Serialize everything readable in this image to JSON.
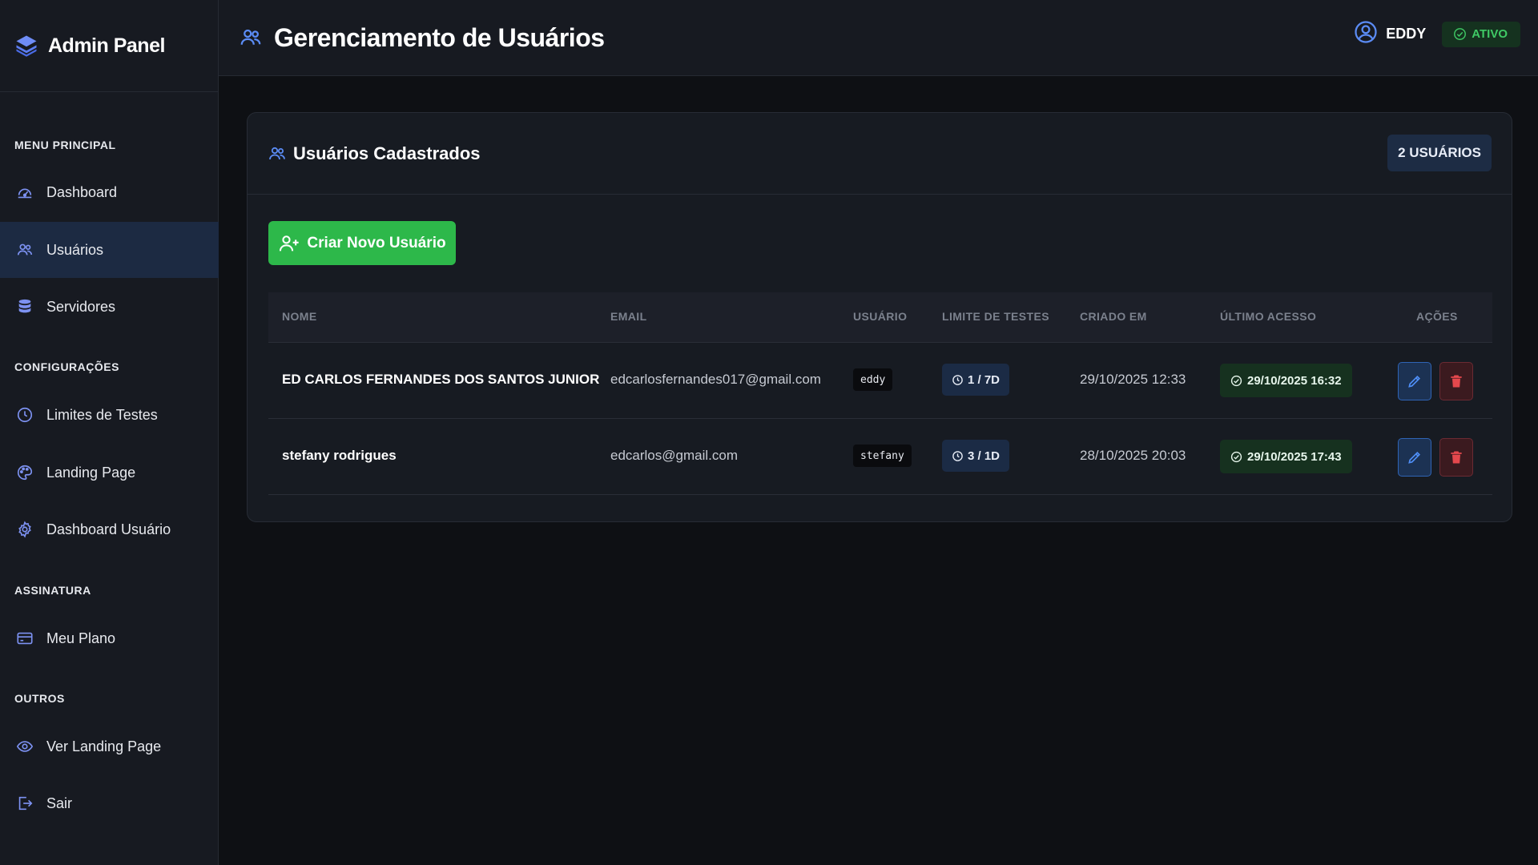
{
  "app": {
    "brand": "Admin Panel"
  },
  "header": {
    "title": "Gerenciamento de Usuários",
    "user_name": "EDDY",
    "status": "ATIVO"
  },
  "sidebar": {
    "sections": [
      {
        "title": "MENU PRINCIPAL",
        "items": [
          {
            "label": "Dashboard",
            "icon": "dashboard-icon"
          },
          {
            "label": "Usuários",
            "icon": "users-icon",
            "active": true
          },
          {
            "label": "Servidores",
            "icon": "database-icon"
          }
        ]
      },
      {
        "title": "CONFIGURAÇÕES",
        "items": [
          {
            "label": "Limites de Testes",
            "icon": "clock-icon"
          },
          {
            "label": "Landing Page",
            "icon": "palette-icon"
          },
          {
            "label": "Dashboard Usuário",
            "icon": "gear-icon"
          }
        ]
      },
      {
        "title": "ASSINATURA",
        "items": [
          {
            "label": "Meu Plano",
            "icon": "credit-card-icon"
          }
        ]
      },
      {
        "title": "OUTROS",
        "items": [
          {
            "label": "Ver Landing Page",
            "icon": "eye-icon"
          },
          {
            "label": "Sair",
            "icon": "logout-icon"
          }
        ]
      }
    ]
  },
  "card": {
    "title": "Usuários Cadastrados",
    "count": "2 USUÁRIOS",
    "create_label": "Criar Novo Usuário"
  },
  "table": {
    "columns": [
      "NOME",
      "EMAIL",
      "USUÁRIO",
      "LIMITE DE TESTES",
      "CRIADO EM",
      "ÚLTIMO ACESSO",
      "AÇÕES"
    ],
    "rows": [
      {
        "name": "ED CARLOS FERNANDES DOS SANTOS JUNIOR",
        "email": "edcarlosfernandes017@gmail.com",
        "username": "eddy",
        "limit": "1 / 7D",
        "created": "29/10/2025 12:33",
        "last_access": "29/10/2025 16:32"
      },
      {
        "name": "stefany rodrigues",
        "email": "edcarlos@gmail.com",
        "username": "stefany",
        "limit": "3 / 1D",
        "created": "28/10/2025 20:03",
        "last_access": "29/10/2025 17:43"
      }
    ]
  },
  "colors": {
    "accent_blue": "#4f8ff7",
    "success_green": "#2db84a",
    "danger_red": "#e5484d",
    "background": "#0e1014",
    "surface": "#171b22"
  }
}
